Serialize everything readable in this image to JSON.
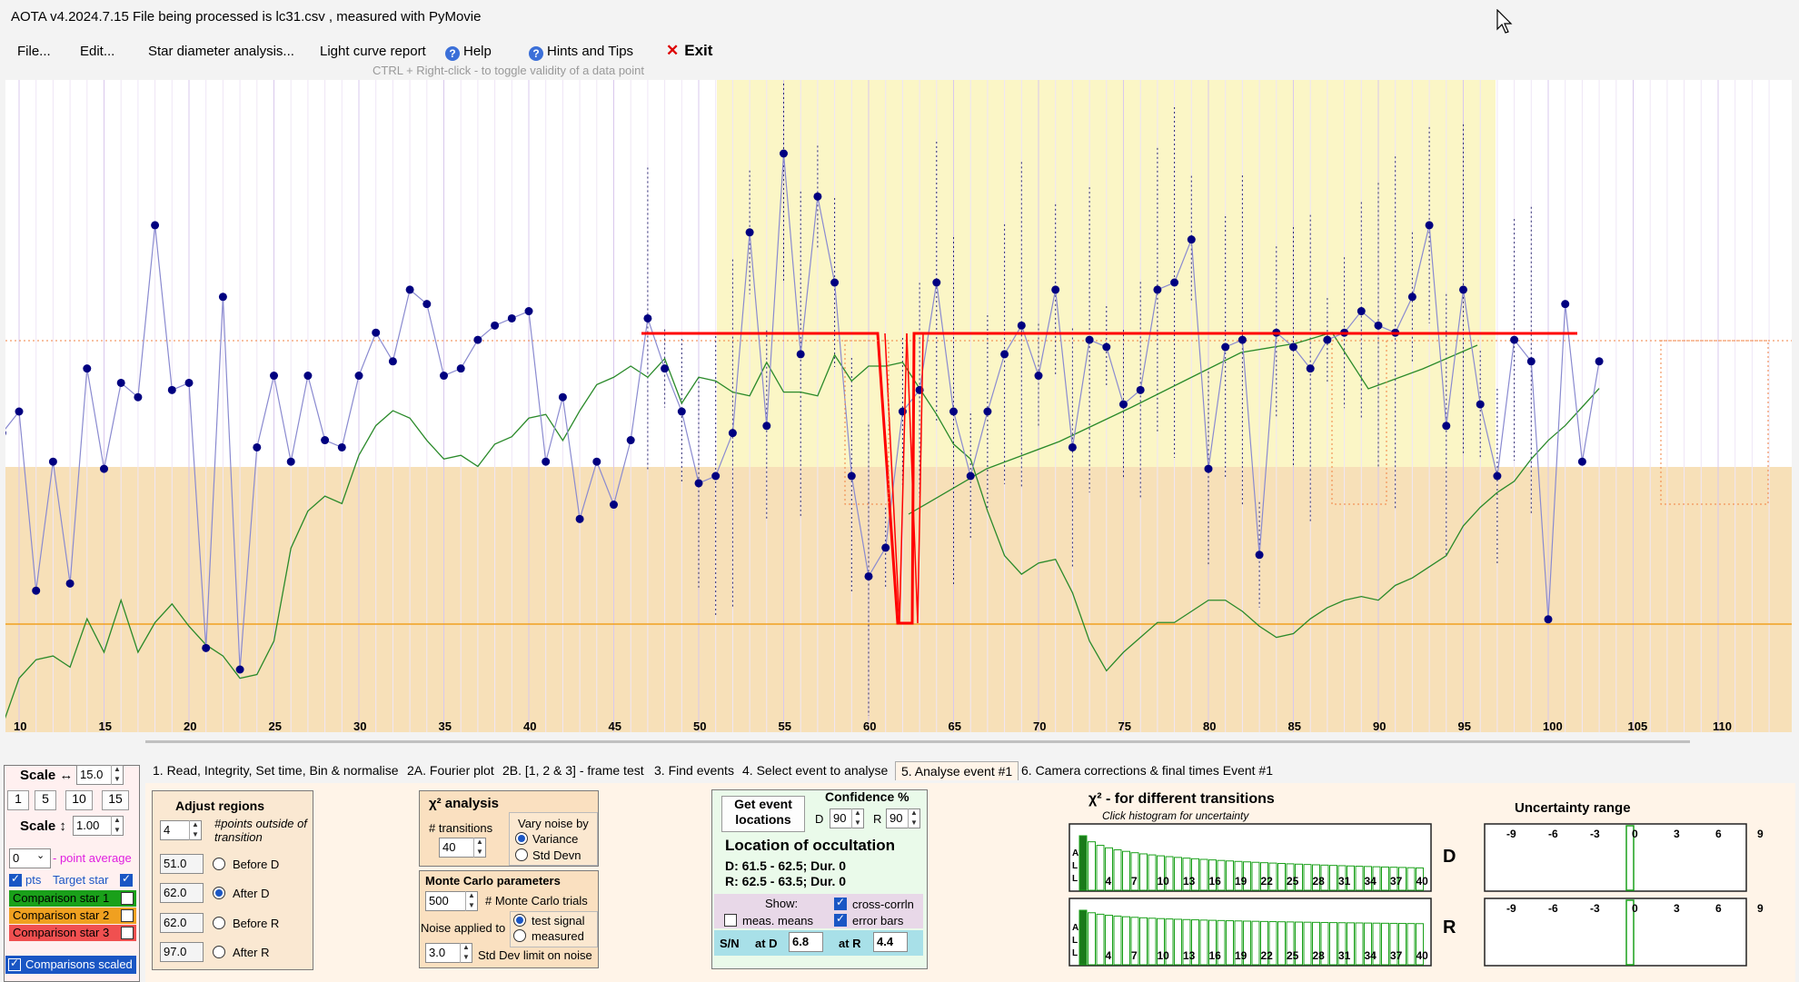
{
  "window": {
    "title": "AOTA v4.2024.7.15    File being processed is  lc31.csv ,  measured with PyMovie"
  },
  "menu": {
    "file": "File...",
    "edit": "Edit...",
    "star_diameter": "Star diameter analysis...",
    "light_curve_report": "Light curve report",
    "help": "Help",
    "hints": "Hints and Tips",
    "exit": "Exit"
  },
  "hint": "CTRL + Right-click  -  to toggle validity of a data point",
  "plot": {
    "x_ticks": [
      "10",
      "15",
      "20",
      "25",
      "30",
      "35",
      "40",
      "45",
      "50",
      "55",
      "60",
      "65",
      "70",
      "75",
      "80",
      "85",
      "90",
      "95",
      "100",
      "105",
      "110"
    ],
    "colors": {
      "target": "#000080",
      "line": "#8a8ad0",
      "comparison": "#2a8a2a",
      "model": "#ff0000",
      "baseline": "#f0a020",
      "event_region": "#fbf6c6",
      "lower_region": "#f7e0b8"
    },
    "target_points": [
      [
        9,
        202
      ],
      [
        10,
        205
      ],
      [
        11,
        180
      ],
      [
        12,
        198
      ],
      [
        13,
        181
      ],
      [
        14,
        211
      ],
      [
        15,
        197
      ],
      [
        16,
        209
      ],
      [
        17,
        207
      ],
      [
        18,
        231
      ],
      [
        19,
        208
      ],
      [
        20,
        209
      ],
      [
        21,
        172
      ],
      [
        22,
        221
      ],
      [
        23,
        169
      ],
      [
        24,
        200
      ],
      [
        25,
        210
      ],
      [
        26,
        198
      ],
      [
        27,
        210
      ],
      [
        28,
        201
      ],
      [
        29,
        200
      ],
      [
        30,
        210
      ],
      [
        31,
        216
      ],
      [
        32,
        212
      ],
      [
        33,
        222
      ],
      [
        34,
        220
      ],
      [
        35,
        210
      ],
      [
        36,
        211
      ],
      [
        37,
        215
      ],
      [
        38,
        217
      ],
      [
        39,
        218
      ],
      [
        40,
        219
      ],
      [
        41,
        198
      ],
      [
        42,
        207
      ],
      [
        43,
        190
      ],
      [
        44,
        198
      ],
      [
        45,
        192
      ],
      [
        46,
        201
      ],
      [
        47,
        218
      ],
      [
        48,
        211
      ],
      [
        49,
        205
      ],
      [
        50,
        195
      ],
      [
        51,
        196
      ],
      [
        52,
        202
      ],
      [
        53,
        230
      ],
      [
        54,
        203
      ],
      [
        55,
        241
      ],
      [
        56,
        213
      ],
      [
        57,
        235
      ],
      [
        58,
        223
      ],
      [
        59,
        196
      ],
      [
        60,
        182
      ],
      [
        61,
        186
      ],
      [
        62,
        205
      ],
      [
        63,
        208
      ],
      [
        64,
        223
      ],
      [
        65,
        205
      ],
      [
        66,
        196
      ],
      [
        67,
        205
      ],
      [
        68,
        213
      ],
      [
        69,
        217
      ],
      [
        70,
        210
      ],
      [
        71,
        222
      ],
      [
        72,
        200
      ],
      [
        73,
        215
      ],
      [
        74,
        214
      ],
      [
        75,
        206
      ],
      [
        76,
        208
      ],
      [
        77,
        222
      ],
      [
        78,
        223
      ],
      [
        79,
        229
      ],
      [
        80,
        197
      ],
      [
        81,
        214
      ],
      [
        82,
        215
      ],
      [
        83,
        185
      ],
      [
        84,
        216
      ],
      [
        85,
        214
      ],
      [
        86,
        211
      ],
      [
        87,
        215
      ],
      [
        88,
        216
      ],
      [
        89,
        219
      ],
      [
        90,
        217
      ],
      [
        91,
        216
      ],
      [
        92,
        221
      ],
      [
        93,
        231
      ],
      [
        94,
        203
      ],
      [
        95,
        222
      ],
      [
        96,
        206
      ],
      [
        97,
        196
      ],
      [
        98,
        215
      ],
      [
        99,
        212
      ],
      [
        100,
        176
      ],
      [
        101,
        220
      ],
      [
        102,
        198
      ],
      [
        103,
        212
      ]
    ],
    "comparison_points": [
      [
        9,
        152
      ],
      [
        10,
        165
      ],
      [
        11,
        170
      ],
      [
        12,
        171
      ],
      [
        13,
        168
      ],
      [
        14,
        181
      ],
      [
        15,
        172
      ],
      [
        16,
        186
      ],
      [
        17,
        172
      ],
      [
        18,
        180
      ],
      [
        19,
        185
      ],
      [
        20,
        179
      ],
      [
        21,
        174
      ],
      [
        22,
        171
      ],
      [
        23,
        165
      ],
      [
        24,
        166
      ],
      [
        25,
        175
      ],
      [
        26,
        200
      ],
      [
        27,
        210
      ],
      [
        28,
        214
      ],
      [
        29,
        212
      ],
      [
        30,
        225
      ],
      [
        31,
        233
      ],
      [
        32,
        237
      ],
      [
        33,
        235
      ],
      [
        34,
        229
      ],
      [
        35,
        224
      ],
      [
        36,
        225
      ],
      [
        37,
        222
      ],
      [
        38,
        228
      ],
      [
        39,
        230
      ],
      [
        40,
        235
      ],
      [
        41,
        236
      ],
      [
        42,
        229
      ],
      [
        43,
        237
      ],
      [
        44,
        244
      ],
      [
        45,
        246
      ],
      [
        46,
        249
      ],
      [
        47,
        246
      ],
      [
        48,
        251
      ],
      [
        49,
        239
      ],
      [
        50,
        246
      ],
      [
        51,
        245
      ],
      [
        52,
        242
      ],
      [
        53,
        241
      ],
      [
        54,
        250
      ],
      [
        55,
        242
      ],
      [
        56,
        242
      ],
      [
        57,
        241
      ],
      [
        58,
        252
      ],
      [
        59,
        245
      ],
      [
        60,
        249
      ],
      [
        61,
        249
      ],
      [
        62,
        250
      ],
      [
        63,
        243
      ],
      [
        64,
        236
      ],
      [
        65,
        228
      ],
      [
        66,
        224
      ],
      [
        67,
        210
      ],
      [
        68,
        198
      ],
      [
        69,
        193
      ],
      [
        70,
        196
      ],
      [
        71,
        197
      ],
      [
        72,
        188
      ],
      [
        73,
        175
      ],
      [
        74,
        167
      ],
      [
        75,
        172
      ],
      [
        76,
        176
      ],
      [
        77,
        180
      ],
      [
        78,
        180
      ],
      [
        79,
        183
      ],
      [
        80,
        186
      ],
      [
        81,
        186
      ],
      [
        82,
        183
      ],
      [
        83,
        179
      ],
      [
        84,
        176
      ],
      [
        85,
        177
      ],
      [
        86,
        181
      ],
      [
        87,
        184
      ],
      [
        88,
        186
      ],
      [
        89,
        187
      ],
      [
        90,
        186
      ],
      [
        91,
        190
      ],
      [
        92,
        192
      ],
      [
        93,
        195
      ],
      [
        94,
        198
      ],
      [
        95,
        206
      ],
      [
        96,
        211
      ],
      [
        97,
        215
      ],
      [
        98,
        218
      ],
      [
        99,
        224
      ],
      [
        100,
        229
      ],
      [
        101,
        233
      ],
      [
        102,
        238
      ],
      [
        103,
        243
      ]
    ]
  },
  "scale": {
    "label_h": "Scale ↔",
    "value_h": "15.0",
    "presets": [
      "1",
      "5",
      "10",
      "15"
    ],
    "label_v": "Scale ↕",
    "value_v": "1.00"
  },
  "point_avg": {
    "value": "0",
    "label": "- point average"
  },
  "series": {
    "pts": "pts",
    "target": "Target star",
    "comp1": "Comparison star 1",
    "comp2": "Comparison star 2",
    "comp3": "Comparison star 3",
    "scaled": "Comparisons scaled"
  },
  "tabs": [
    "1.  Read, Integrity, Set time, Bin & normalise",
    "2A. Fourier plot",
    "2B. [1, 2 & 3] - frame test",
    "3. Find events",
    "4. Select event to analyse",
    "5. Analyse event #1",
    "6. Camera corrections & final times Event #1"
  ],
  "adjust": {
    "title": "Adjust regions",
    "points": "4",
    "points_label": "#points outside of transition",
    "before_d": "51.0",
    "after_d": "62.0",
    "before_r": "62.0",
    "after_r": "97.0",
    "before_d_label": "Before D",
    "after_d_label": "After D",
    "before_r_label": "Before R",
    "after_r_label": "After R"
  },
  "chi": {
    "title": "χ² analysis",
    "transitions_label": "# transitions",
    "transitions": "40",
    "vary_label": "Vary noise by",
    "variance": "Variance",
    "stddev": "Std Devn"
  },
  "monte": {
    "title": "Monte Carlo parameters",
    "trials": "500",
    "trials_label": "# Monte Carlo trials",
    "noise_label": "Noise applied to",
    "test_signal": "test signal",
    "measured": "measured",
    "sd_limit": "3.0",
    "sd_label": "Std Dev limit on noise"
  },
  "event": {
    "get_button": "Get event locations",
    "confidence": "Confidence %",
    "d": "D",
    "d_val": "90",
    "r": "R",
    "r_val": "90",
    "location_title": "Location of occultation",
    "d_loc": "D: 61.5 - 62.5; Dur. 0",
    "r_loc": "R: 62.5 - 63.5; Dur. 0",
    "show": "Show:",
    "means": "meas. means",
    "crosscorr": "cross-corrln",
    "errorbars": "error bars",
    "sn": "S/N",
    "at_d": "at D",
    "at_d_val": "6.8",
    "at_r": "at R",
    "at_r_val": "4.4"
  },
  "chi_plot": {
    "title": "χ² -  for different transitions",
    "subtitle": "Click histogram for uncertainty",
    "ticks": [
      "4",
      "7",
      "10",
      "13",
      "16",
      "19",
      "22",
      "25",
      "28",
      "31",
      "34",
      "37",
      "40"
    ],
    "d": "D",
    "r": "R",
    "side": [
      "A",
      "L",
      "L"
    ]
  },
  "uncert": {
    "title": "Uncertainty range",
    "ticks": [
      "-9",
      "-6",
      "-3",
      "0",
      "3",
      "6",
      "9"
    ]
  }
}
